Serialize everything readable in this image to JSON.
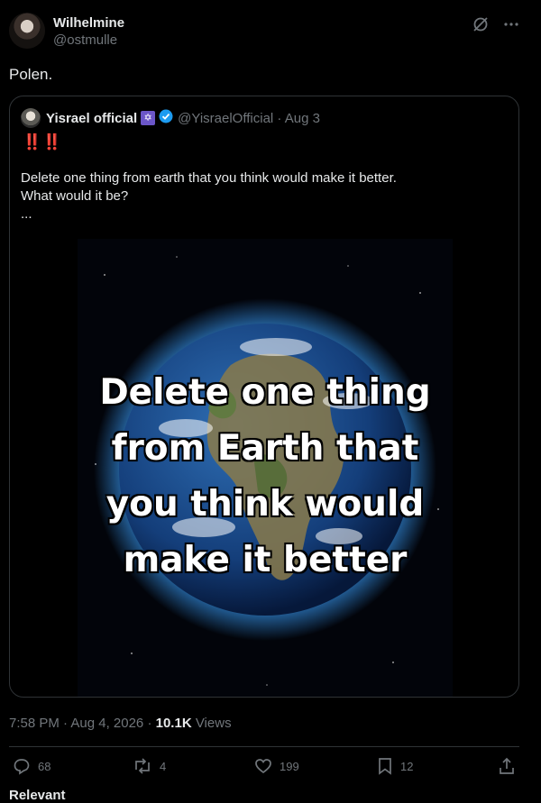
{
  "post": {
    "display_name": "Wilhelmine",
    "handle": "@ostmulle",
    "text": "Polen.",
    "timestamp": "7:58 PM · Aug 4, 2026",
    "views_count": "10.1K",
    "views_label": "Views"
  },
  "quote": {
    "display_name": "Yisrael official",
    "badge_icon": "menorah-icon",
    "verified_color": "#1d9bf0",
    "handle_date": "@YisraelOfficial · Aug 3",
    "bangs": "‼️‼️",
    "text_line1": "Delete one thing from earth that you think would make it better.",
    "text_line2": "What would it be?",
    "text_line3": "...",
    "image_caption": {
      "line1": "Delete one thing",
      "line2": "from Earth that",
      "line3": "you think would",
      "line4": "make it better"
    }
  },
  "actions": {
    "replies": "68",
    "reposts": "4",
    "likes": "199",
    "bookmarks": "12"
  },
  "footer": {
    "section_label": "Relevant"
  },
  "colors": {
    "background": "#000000",
    "text": "#e7e9ea",
    "muted": "#71767b",
    "border": "#2f3336",
    "alert": "#f4212e"
  }
}
